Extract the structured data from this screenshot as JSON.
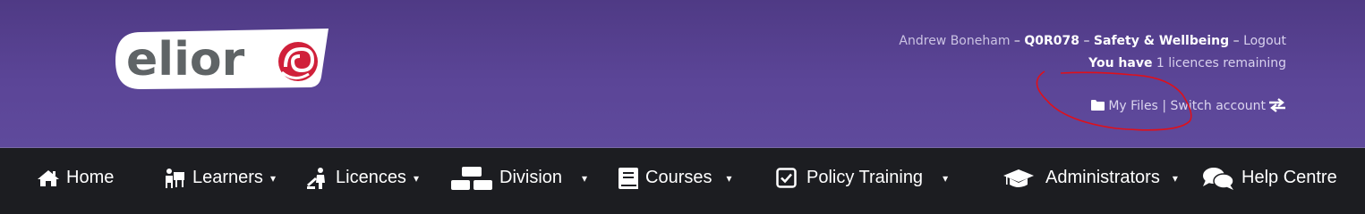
{
  "brand": {
    "logo_text": "elior"
  },
  "account": {
    "user_name": "Andrew Boneham",
    "separator": "–",
    "account_code": "Q0R078",
    "account_name": "Safety & Wellbeing",
    "logout_label": "Logout",
    "licences_prefix": "You have",
    "licences_remaining": "1 licences remaining",
    "my_files_label": "My Files",
    "pipe": "|",
    "switch_account_label": "Switch account"
  },
  "nav": {
    "home": "Home",
    "learners": "Learners",
    "licences": "Licences",
    "division": "Division",
    "courses": "Courses",
    "policy_training": "Policy Training",
    "administrators": "Administrators",
    "help_centre": "Help Centre",
    "caret": "▾"
  },
  "colors": {
    "header_purple": "#5b4597",
    "navbar_dark": "#1c1d21",
    "logo_red": "#d0203a",
    "annotation_red": "#e0101a"
  }
}
